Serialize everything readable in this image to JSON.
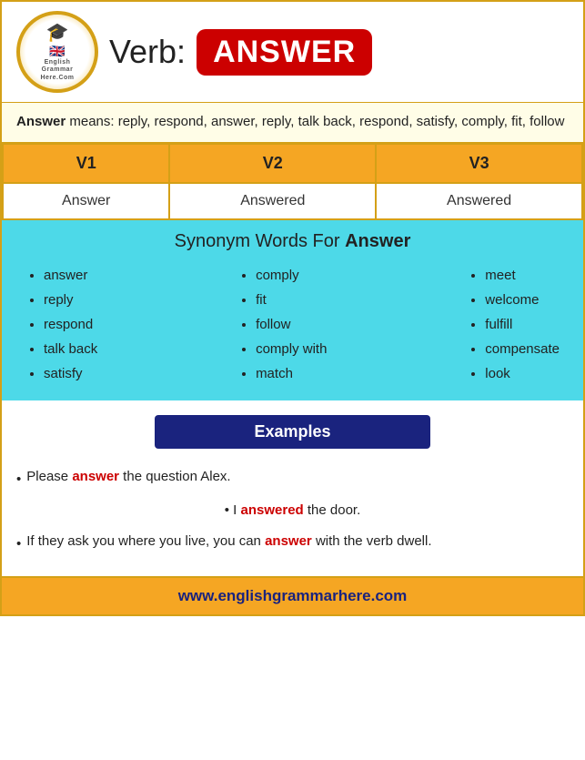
{
  "header": {
    "verb_label": "Verb:",
    "answer_badge": "ANSWER",
    "logo_alt": "English Grammar Here"
  },
  "means": {
    "label": "Answer",
    "text": " means: reply, respond, answer, reply, talk back, respond, satisfy, comply, fit, follow"
  },
  "verb_table": {
    "headers": [
      "V1",
      "V2",
      "V3"
    ],
    "rows": [
      [
        "Answer",
        "Answered",
        "Answered"
      ]
    ]
  },
  "synonym": {
    "title": "Synonym Words For ",
    "title_bold": "Answer",
    "columns": [
      [
        "answer",
        "reply",
        "respond",
        "talk back",
        "satisfy"
      ],
      [
        "comply",
        "fit",
        "follow",
        "comply with",
        "match"
      ],
      [
        "meet",
        "welcome",
        "fulfill",
        "compensate",
        "look"
      ]
    ]
  },
  "examples": {
    "header": "Examples",
    "items": [
      {
        "type": "normal",
        "parts": [
          {
            "text": "Please ",
            "highlight": false
          },
          {
            "text": "answer",
            "highlight": true
          },
          {
            "text": " the question Alex.",
            "highlight": false
          }
        ]
      },
      {
        "type": "centered",
        "parts": [
          {
            "text": "I ",
            "highlight": false
          },
          {
            "text": "answered",
            "highlight": true
          },
          {
            "text": " the door.",
            "highlight": false
          }
        ]
      },
      {
        "type": "normal",
        "parts": [
          {
            "text": "If they ask you where you live, you can ",
            "highlight": false
          },
          {
            "text": "answer",
            "highlight": true
          },
          {
            "text": " with the verb dwell.",
            "highlight": false
          }
        ]
      }
    ]
  },
  "footer": {
    "url": "www.englishgrammarhere.com"
  }
}
